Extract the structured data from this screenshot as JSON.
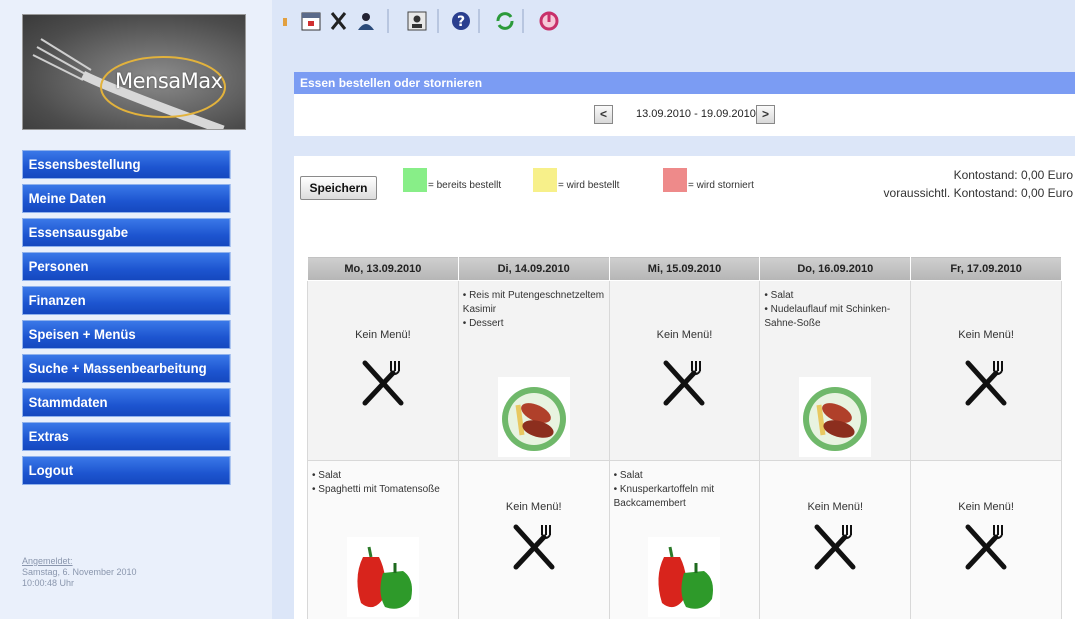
{
  "app": {
    "logo_text": "MensaMax"
  },
  "sidebar": {
    "items": [
      {
        "label": "Essensbestellung"
      },
      {
        "label": "Meine Daten"
      },
      {
        "label": "Essensausgabe"
      },
      {
        "label": "Personen"
      },
      {
        "label": "Finanzen"
      },
      {
        "label": "Speisen + Menüs"
      },
      {
        "label": "Suche + Massenbearbeitung"
      },
      {
        "label": "Stammdaten"
      },
      {
        "label": "Extras"
      },
      {
        "label": "Logout"
      }
    ],
    "login": {
      "label": "Angemeldet:",
      "date": "Samstag, 6. November 2010",
      "time": "10:00:48 Uhr"
    }
  },
  "toolbar": {
    "icons": [
      "calendar-icon",
      "cutlery-icon",
      "person-icon",
      "id-card-icon",
      "help-icon",
      "refresh-icon",
      "power-icon"
    ]
  },
  "header": {
    "title": "Essen bestellen oder stornieren"
  },
  "week": {
    "range": "13.09.2010 - 19.09.2010",
    "prev": "<",
    "next": ">"
  },
  "actions": {
    "save_label": "Speichern"
  },
  "legend": [
    {
      "color": "#88ee88",
      "label": "= bereits bestellt"
    },
    {
      "color": "#f7f08a",
      "label": "= wird bestellt"
    },
    {
      "color": "#ee8a8a",
      "label": "= wird storniert"
    }
  ],
  "account": {
    "balance": "Kontostand: 0,00 Euro",
    "expected": "voraussichtl. Kontostand: 0,00 Euro"
  },
  "table": {
    "days": [
      "Mo, 13.09.2010",
      "Di, 14.09.2010",
      "Mi, 15.09.2010",
      "Do, 16.09.2010",
      "Fr, 17.09.2010"
    ],
    "no_menu": "Kein Menü!",
    "row1": [
      {
        "type": "none"
      },
      {
        "type": "menu",
        "items": [
          "Reis mit Putengeschnetzeltem Kasimir",
          "Dessert"
        ],
        "image": "sausage-plate"
      },
      {
        "type": "none"
      },
      {
        "type": "menu",
        "items": [
          "Salat",
          "Nudelauflauf mit Schinken-Sahne-Soße"
        ],
        "image": "sausage-plate"
      },
      {
        "type": "none"
      }
    ],
    "row2": [
      {
        "type": "menu",
        "items": [
          "Salat",
          "Spaghetti mit Tomatensoße"
        ],
        "image": "peppers"
      },
      {
        "type": "none"
      },
      {
        "type": "menu",
        "items": [
          "Salat",
          "Knusperkartoffeln mit Backcamembert"
        ],
        "image": "peppers"
      },
      {
        "type": "none"
      },
      {
        "type": "none"
      }
    ]
  }
}
